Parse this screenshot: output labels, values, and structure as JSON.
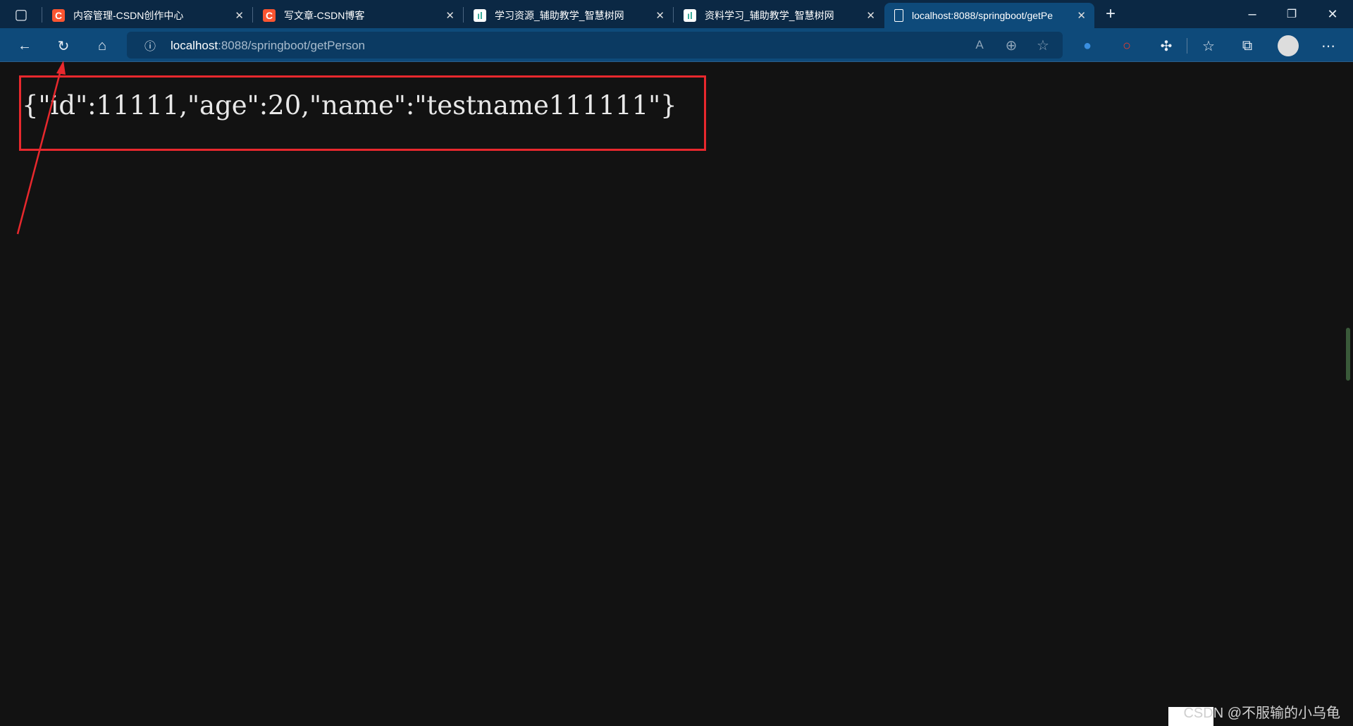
{
  "tabs": [
    {
      "title": "内容管理-CSDN创作中心",
      "icon": "csdn-icon"
    },
    {
      "title": "写文章-CSDN博客",
      "icon": "csdn-icon"
    },
    {
      "title": "学习资源_辅助教学_智慧树网",
      "icon": "zhihuishu-icon"
    },
    {
      "title": "资料学习_辅助教学_智慧树网",
      "icon": "zhihuishu-icon"
    },
    {
      "title": "localhost:8088/springboot/getPe",
      "icon": "page-icon",
      "active": true
    }
  ],
  "address": {
    "host": "localhost",
    "rest": ":8088/springboot/getPerson"
  },
  "content": {
    "json_text": "{\"id\":11111,\"age\":20,\"name\":\"testname111111\"}"
  },
  "annotation": {
    "box_color": "#e8282d",
    "arrow_color": "#e8282d"
  },
  "watermark": "CSDN @不服输的小乌龟",
  "colors": {
    "tabbar": "#0b2844",
    "toolbar": "#0e4a7a",
    "page_bg": "#121212",
    "csdn": "#fc5531"
  }
}
